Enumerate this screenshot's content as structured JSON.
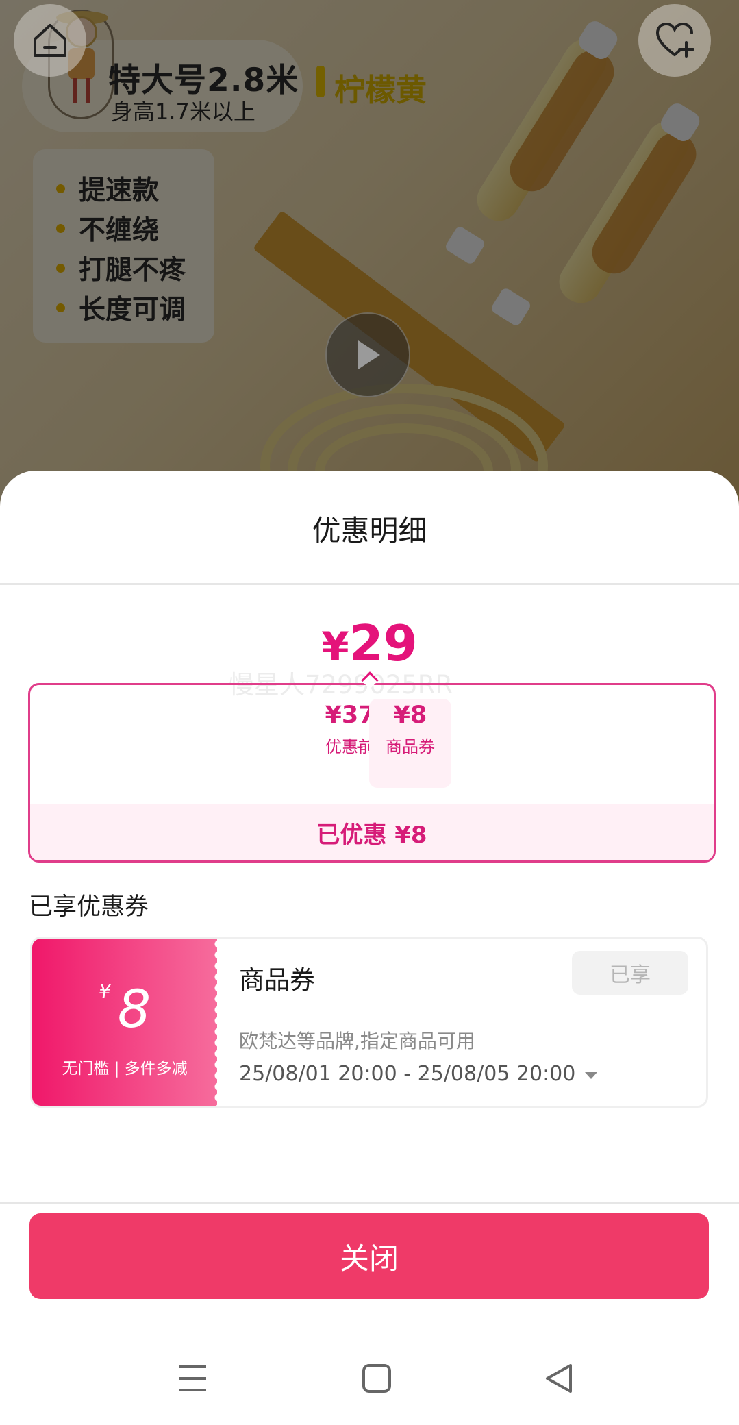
{
  "product_image": {
    "size_title": "特大号2.8米",
    "size_note": "身高1.7米以上",
    "color_name": "柠檬黄",
    "features": [
      "提速款",
      "不缠绕",
      "打腿不疼",
      "长度可调"
    ]
  },
  "sheet": {
    "title": "优惠明细",
    "final_price": {
      "currency": "¥",
      "amount": "29"
    },
    "watermark": "慢星人7299025RR",
    "breakdown": {
      "before": {
        "value": "¥37",
        "label": "优惠前"
      },
      "operator": "-",
      "coupon": {
        "value": "¥8",
        "label": "商品券"
      },
      "saved_text": "已优惠 ¥8"
    },
    "section_title": "已享优惠券",
    "coupon": {
      "currency": "¥",
      "amount": "8",
      "condition": "无门槛 | 多件多减",
      "name": "商品券",
      "status": "已享",
      "scope": "欧梵达等品牌,指定商品可用",
      "validity": "25/08/01 20:00 - 25/08/05 20:00"
    },
    "close_label": "关闭"
  },
  "colors": {
    "accent": "#e4137a",
    "close_button": "#ef3a68",
    "coupon_gradient_start": "#f0186a",
    "coupon_gradient_end": "#f66c9c"
  },
  "icons": {
    "home": "home-icon",
    "favorite": "heart-plus-icon",
    "play": "play-icon",
    "nav_menu": "menu-icon",
    "nav_home": "square-icon",
    "nav_back": "back-triangle-icon"
  }
}
